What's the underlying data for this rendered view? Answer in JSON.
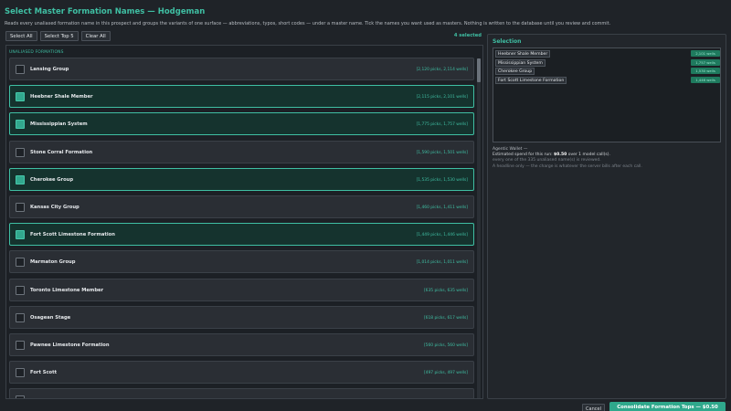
{
  "header": {
    "title": "Select Master Formation Names — Hodgeman",
    "subtitle": "Reads every unaliased formation name in this prospect and groups the variants of one surface — abbreviations, typos, short codes — under a master name. Tick the names you want used as masters. Nothing is written to the database until you review and commit."
  },
  "toolbar": {
    "select_all": "Select All",
    "select_top5": "Select Top 5",
    "clear_all": "Clear All",
    "selected_count": "4 selected"
  },
  "list": {
    "header": "UNALIASED FORMATIONS",
    "rows": [
      {
        "name": "Lansing Group",
        "stats": "[2,120 picks, 2,114 wells]",
        "selected": false
      },
      {
        "name": "Heebner Shale Member",
        "stats": "[2,115 picks, 2,101 wells]",
        "selected": true
      },
      {
        "name": "Mississippian System",
        "stats": "[1,775 picks, 1,757 wells]",
        "selected": true
      },
      {
        "name": "Stone Corral Formation",
        "stats": "[1,590 picks, 1,501 wells]",
        "selected": false
      },
      {
        "name": "Cherokee Group",
        "stats": "[1,535 picks, 1,530 wells]",
        "selected": true
      },
      {
        "name": "Kansas City Group",
        "stats": "[1,460 picks, 1,411 wells]",
        "selected": false
      },
      {
        "name": "Fort Scott Limestone Formation",
        "stats": "[1,449 picks, 1,446 wells]",
        "selected": true
      },
      {
        "name": "Marmaton Group",
        "stats": "[1,014 picks, 1,011 wells]",
        "selected": false
      },
      {
        "name": "Toronto Limestone Member",
        "stats": "[635 picks, 635 wells]",
        "selected": false
      },
      {
        "name": "Osagean Stage",
        "stats": "[618 picks, 617 wells]",
        "selected": false
      },
      {
        "name": "Pawnee Limestone Formation",
        "stats": "[560 picks, 560 wells]",
        "selected": false
      },
      {
        "name": "Fort Scott",
        "stats": "[497 picks, 497 wells]",
        "selected": false
      },
      {
        "name": "",
        "stats": "",
        "selected": false
      }
    ]
  },
  "selection": {
    "heading": "Selection",
    "items": [
      {
        "name": "Heebner Shale Member",
        "badge": "2,101 wells"
      },
      {
        "name": "Mississippian System",
        "badge": "1,757 wells"
      },
      {
        "name": "Cherokee Group",
        "badge": "1,530 wells"
      },
      {
        "name": "Fort Scott Limestone Formation",
        "badge": "1,446 wells"
      }
    ]
  },
  "wallet": {
    "line1": "Agentic Wallet —",
    "line2_pre": "Estimated spend for this run: ",
    "line2_amount": "$0.50",
    "line2_post": " over 1 model call(s).",
    "line3": "every one of the 335 unaliased name(s) is reviewed.",
    "line4": "A headline only — the charge is whatever the server bills after each call."
  },
  "footer": {
    "cancel": "Cancel",
    "consolidate": "Consolidate Formation Tops — $0.50"
  },
  "colors": {
    "accent": "#3fbfa3",
    "background": "#1f2328",
    "selected_row": "#15332e",
    "button_primary": "#2fa88c"
  }
}
